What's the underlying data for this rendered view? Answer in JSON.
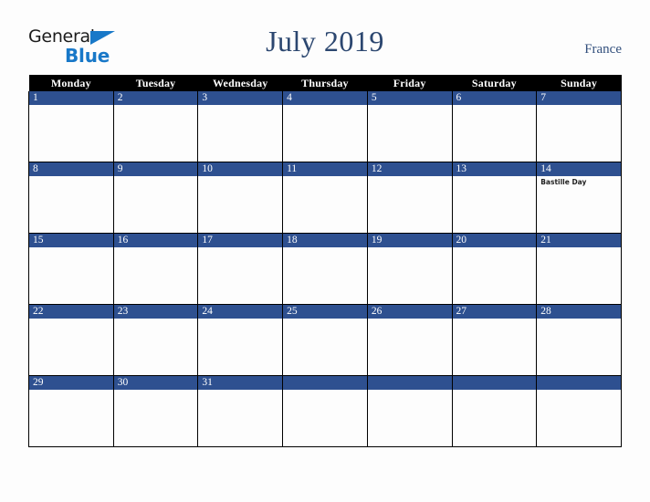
{
  "brand": {
    "word1": "General",
    "word2": "Blue",
    "triangle_color": "#1878c8"
  },
  "header": {
    "title": "July 2019",
    "country": "France",
    "title_color": "#2c4770",
    "country_color": "#33507d"
  },
  "calendar": {
    "weekday_headers": [
      "Monday",
      "Tuesday",
      "Wednesday",
      "Thursday",
      "Friday",
      "Saturday",
      "Sunday"
    ],
    "header_bg": "#000000",
    "day_banner_bg": "#2e5090",
    "cell_bg": "#fdfdfd",
    "grid_line_color": "#000000",
    "weeks": [
      [
        {
          "num": "1",
          "events": []
        },
        {
          "num": "2",
          "events": []
        },
        {
          "num": "3",
          "events": []
        },
        {
          "num": "4",
          "events": []
        },
        {
          "num": "5",
          "events": []
        },
        {
          "num": "6",
          "events": []
        },
        {
          "num": "7",
          "events": []
        }
      ],
      [
        {
          "num": "8",
          "events": []
        },
        {
          "num": "9",
          "events": []
        },
        {
          "num": "10",
          "events": []
        },
        {
          "num": "11",
          "events": []
        },
        {
          "num": "12",
          "events": []
        },
        {
          "num": "13",
          "events": []
        },
        {
          "num": "14",
          "events": [
            "Bastille Day"
          ]
        }
      ],
      [
        {
          "num": "15",
          "events": []
        },
        {
          "num": "16",
          "events": []
        },
        {
          "num": "17",
          "events": []
        },
        {
          "num": "18",
          "events": []
        },
        {
          "num": "19",
          "events": []
        },
        {
          "num": "20",
          "events": []
        },
        {
          "num": "21",
          "events": []
        }
      ],
      [
        {
          "num": "22",
          "events": []
        },
        {
          "num": "23",
          "events": []
        },
        {
          "num": "24",
          "events": []
        },
        {
          "num": "25",
          "events": []
        },
        {
          "num": "26",
          "events": []
        },
        {
          "num": "27",
          "events": []
        },
        {
          "num": "28",
          "events": []
        }
      ],
      [
        {
          "num": "29",
          "events": []
        },
        {
          "num": "30",
          "events": []
        },
        {
          "num": "31",
          "events": []
        },
        {
          "num": "",
          "events": []
        },
        {
          "num": "",
          "events": []
        },
        {
          "num": "",
          "events": []
        },
        {
          "num": "",
          "events": []
        }
      ]
    ]
  }
}
